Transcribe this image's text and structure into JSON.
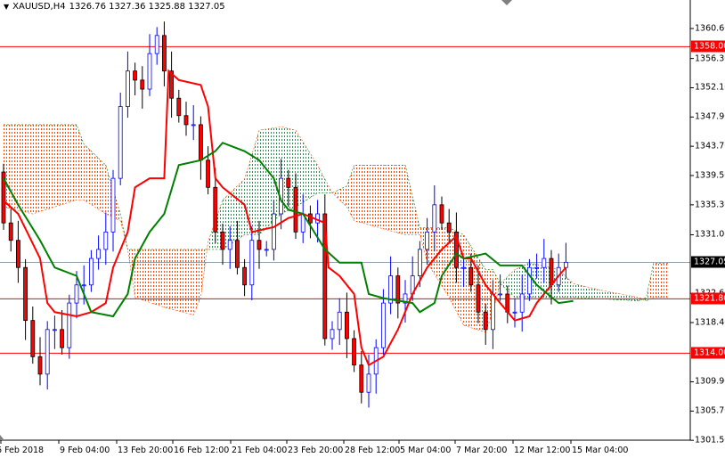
{
  "header": {
    "symbol": "XAUUSD,H4",
    "ohlc": "1326.76 1327.36 1325.88 1327.05"
  },
  "colors": {
    "bull": "#0000ff",
    "bear_body": "#ff0000",
    "tenkan": "#ff0000",
    "kijun": "#008000",
    "cloud_bear": "#ff4500",
    "cloud_bull": "#2e8b57",
    "hline": "#ff0000",
    "price_line": "#708090"
  },
  "chart_data": {
    "type": "candlestick",
    "title": "XAUUSD,H4",
    "ylim": [
      1301.5,
      1360.6
    ],
    "y_ticks": [
      "1360.60",
      "1356.30",
      "1352.10",
      "1347.90",
      "1343.70",
      "1339.50",
      "1335.30",
      "1331.00",
      "1322.60",
      "1318.40",
      "1309.90",
      "1305.70",
      "1301.50"
    ],
    "x_ticks": [
      "6 Feb 2018",
      "9 Feb 04:00",
      "13 Feb 20:00",
      "16 Feb 12:00",
      "21 Feb 04:00",
      "23 Feb 20:00",
      "28 Feb 12:00",
      "5 Mar 04:00",
      "7 Mar 20:00",
      "12 Mar 12:00",
      "15 Mar 04:00"
    ],
    "closes": [
      1332.7,
      1330.2,
      1326.3,
      1318.7,
      1313.5,
      1311.0,
      1317.4,
      1317.4,
      1314.8,
      1321.2,
      1323.8,
      1323.8,
      1327.6,
      1328.9,
      1331.4,
      1339.1,
      1349.4,
      1354.5,
      1353.2,
      1351.9,
      1357.0,
      1359.6,
      1354.5,
      1350.6,
      1348.1,
      1346.8,
      1346.8,
      1341.7,
      1337.8,
      1331.4,
      1328.9,
      1330.2,
      1326.3,
      1323.8,
      1330.2,
      1328.9,
      1328.9,
      1334.0,
      1339.1,
      1337.8,
      1331.4,
      1334.0,
      1332.7,
      1334.0,
      1316.1,
      1317.4,
      1319.9,
      1316.1,
      1312.3,
      1308.4,
      1311.0,
      1314.8,
      1321.2,
      1325.1,
      1321.2,
      1322.5,
      1325.1,
      1328.9,
      1331.4,
      1335.3,
      1332.7,
      1331.4,
      1326.3,
      1326.3,
      1323.8,
      1319.9,
      1317.4,
      1322.5,
      1322.5,
      1319.9,
      1319.9,
      1322.5,
      1326.3,
      1326.3,
      1327.6,
      1323.8,
      1326.3,
      1327.05
    ],
    "first_open": 1340.0,
    "tenkan": [
      [
        0,
        1335.9
      ],
      [
        2,
        1334.0
      ],
      [
        5,
        1327.6
      ],
      [
        6,
        1321.2
      ],
      [
        7,
        1319.9
      ],
      [
        10,
        1319.3
      ],
      [
        12,
        1319.9
      ],
      [
        14,
        1321.2
      ],
      [
        15,
        1326.3
      ],
      [
        17,
        1331.4
      ],
      [
        18,
        1337.8
      ],
      [
        20,
        1339.1
      ],
      [
        22,
        1339.1
      ],
      [
        22.6,
        1354.5
      ],
      [
        24,
        1353.2
      ],
      [
        27,
        1352.5
      ],
      [
        28,
        1349.4
      ],
      [
        29,
        1339.1
      ],
      [
        30,
        1337.8
      ],
      [
        33,
        1335.3
      ],
      [
        34,
        1331.4
      ],
      [
        37,
        1332.1
      ],
      [
        39,
        1333.4
      ],
      [
        41,
        1334.0
      ],
      [
        44,
        1332.7
      ],
      [
        44.5,
        1326.3
      ],
      [
        46,
        1325.1
      ],
      [
        48,
        1322.5
      ],
      [
        49,
        1314.8
      ],
      [
        50,
        1312.3
      ],
      [
        52,
        1313.5
      ],
      [
        54,
        1317.4
      ],
      [
        56,
        1322.5
      ],
      [
        58,
        1326.3
      ],
      [
        60,
        1328.9
      ],
      [
        62,
        1330.8
      ],
      [
        63,
        1327.6
      ],
      [
        64,
        1327.6
      ],
      [
        66,
        1323.8
      ],
      [
        68,
        1321.2
      ],
      [
        70,
        1318.7
      ],
      [
        72,
        1319.3
      ],
      [
        73,
        1321.2
      ],
      [
        76,
        1325.1
      ],
      [
        77,
        1326.3
      ]
    ],
    "kijun": [
      [
        0,
        1339.1
      ],
      [
        2,
        1335.3
      ],
      [
        5,
        1330.2
      ],
      [
        7,
        1326.3
      ],
      [
        10,
        1325.1
      ],
      [
        12,
        1319.9
      ],
      [
        15,
        1319.3
      ],
      [
        17,
        1322.5
      ],
      [
        18,
        1327.6
      ],
      [
        20,
        1331.4
      ],
      [
        22,
        1334.0
      ],
      [
        24,
        1341.0
      ],
      [
        27,
        1341.7
      ],
      [
        29,
        1343.0
      ],
      [
        30,
        1344.2
      ],
      [
        33,
        1343.0
      ],
      [
        35,
        1341.7
      ],
      [
        37,
        1339.1
      ],
      [
        38,
        1335.9
      ],
      [
        39,
        1334.6
      ],
      [
        41,
        1334.0
      ],
      [
        44,
        1328.9
      ],
      [
        46,
        1327.0
      ],
      [
        49,
        1327.0
      ],
      [
        50,
        1322.5
      ],
      [
        52,
        1321.9
      ],
      [
        56,
        1321.2
      ],
      [
        57,
        1319.9
      ],
      [
        59,
        1321.2
      ],
      [
        60,
        1325.1
      ],
      [
        62,
        1328.3
      ],
      [
        63,
        1327.6
      ],
      [
        66,
        1328.3
      ],
      [
        68,
        1326.6
      ],
      [
        71,
        1326.6
      ],
      [
        73,
        1323.8
      ],
      [
        76,
        1321.2
      ],
      [
        78,
        1321.5
      ]
    ],
    "cloud": [
      [
        0,
        1335,
        1346.8
      ],
      [
        4,
        1334,
        1346.8
      ],
      [
        10,
        1336,
        1346.8
      ],
      [
        11,
        1336,
        1344
      ],
      [
        14,
        1334,
        1341
      ],
      [
        16,
        1333,
        1334
      ],
      [
        17,
        1328.9,
        1328.9
      ],
      [
        18,
        1322,
        1328.9
      ],
      [
        22,
        1320.6,
        1328.9
      ],
      [
        26,
        1319.5,
        1328.9
      ],
      [
        27,
        1322,
        1328.9
      ],
      [
        28,
        1330,
        1328.9
      ],
      [
        30,
        1336,
        1328.9
      ],
      [
        33,
        1339,
        1331
      ],
      [
        35,
        1346,
        1331
      ],
      [
        38,
        1346.5,
        1334
      ],
      [
        40,
        1346,
        1335
      ],
      [
        43,
        1341,
        1337
      ],
      [
        45,
        1337,
        1337
      ],
      [
        47,
        1335,
        1338
      ],
      [
        48,
        1333,
        1341
      ],
      [
        55,
        1331,
        1341
      ],
      [
        57,
        1331,
        1332
      ],
      [
        58,
        1327,
        1332
      ],
      [
        61,
        1322,
        1332
      ],
      [
        63,
        1318,
        1331
      ],
      [
        66,
        1317,
        1326
      ],
      [
        67,
        1320,
        1326
      ],
      [
        68,
        1324,
        1324
      ],
      [
        70,
        1326,
        1322
      ],
      [
        72,
        1327,
        1322
      ],
      [
        76,
        1326,
        1322
      ],
      [
        78,
        1324,
        1322
      ],
      [
        82,
        1323,
        1321.8
      ],
      [
        87,
        1322,
        1321.5
      ],
      [
        88,
        1321.5,
        1322
      ],
      [
        89,
        1322,
        1326.9
      ],
      [
        91,
        1322,
        1326.9
      ]
    ],
    "hlines": [
      {
        "price": 1358.0,
        "label": "1358.00"
      },
      {
        "price": 1321.8,
        "label": "1321.80"
      },
      {
        "price": 1314.0,
        "label": "1314.00"
      }
    ],
    "current_price": {
      "price": 1327.05,
      "label": "1327.05"
    }
  }
}
